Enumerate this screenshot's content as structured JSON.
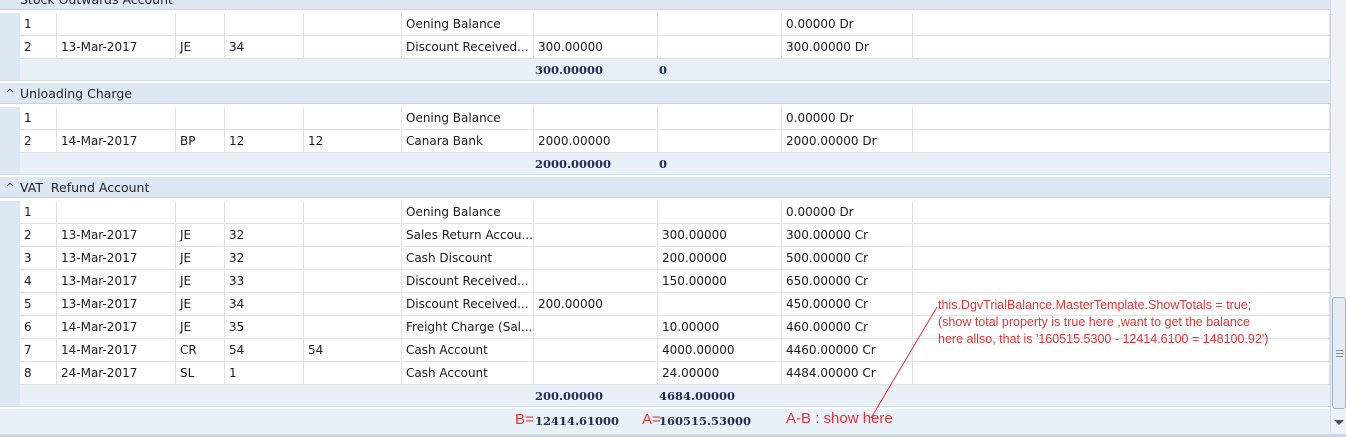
{
  "groups": [
    {
      "title": "Stock Outwards Account",
      "rows": [
        {
          "no": "1",
          "date": "",
          "type": "",
          "vno": "",
          "ref": "",
          "particulars": "Oening Balance",
          "debit": "",
          "credit": "",
          "balance": "0.00000 Dr"
        },
        {
          "no": "2",
          "date": "13-Mar-2017",
          "type": "JE",
          "vno": "34",
          "ref": "",
          "particulars": "Discount Received...",
          "debit": "300.00000",
          "credit": "",
          "balance": "300.00000 Dr"
        }
      ],
      "totals": {
        "debit": "300.00000",
        "credit": "0"
      }
    },
    {
      "title": "Unloading Charge",
      "rows": [
        {
          "no": "1",
          "date": "",
          "type": "",
          "vno": "",
          "ref": "",
          "particulars": "Oening Balance",
          "debit": "",
          "credit": "",
          "balance": "0.00000 Dr"
        },
        {
          "no": "2",
          "date": "14-Mar-2017",
          "type": "BP",
          "vno": "12",
          "ref": "12",
          "particulars": "Canara Bank",
          "debit": "2000.00000",
          "credit": "",
          "balance": "2000.00000 Dr"
        }
      ],
      "totals": {
        "debit": "2000.00000",
        "credit": "0"
      }
    },
    {
      "title": "VAT  Refund Account",
      "rows": [
        {
          "no": "1",
          "date": "",
          "type": "",
          "vno": "",
          "ref": "",
          "particulars": "Oening Balance",
          "debit": "",
          "credit": "",
          "balance": "0.00000 Dr"
        },
        {
          "no": "2",
          "date": "13-Mar-2017",
          "type": "JE",
          "vno": "32",
          "ref": "",
          "particulars": "Sales Return Accou...",
          "debit": "",
          "credit": "300.00000",
          "balance": "300.00000 Cr"
        },
        {
          "no": "3",
          "date": "13-Mar-2017",
          "type": "JE",
          "vno": "32",
          "ref": "",
          "particulars": "Cash Discount",
          "debit": "",
          "credit": "200.00000",
          "balance": "500.00000 Cr"
        },
        {
          "no": "4",
          "date": "13-Mar-2017",
          "type": "JE",
          "vno": "33",
          "ref": "",
          "particulars": "Discount Received...",
          "debit": "",
          "credit": "150.00000",
          "balance": "650.00000 Cr"
        },
        {
          "no": "5",
          "date": "13-Mar-2017",
          "type": "JE",
          "vno": "34",
          "ref": "",
          "particulars": "Discount Received...",
          "debit": "200.00000",
          "credit": "",
          "balance": "450.00000 Cr"
        },
        {
          "no": "6",
          "date": "14-Mar-2017",
          "type": "JE",
          "vno": "35",
          "ref": "",
          "particulars": "Freight Charge (Sal...",
          "debit": "",
          "credit": "10.00000",
          "balance": "460.00000 Cr"
        },
        {
          "no": "7",
          "date": "14-Mar-2017",
          "type": "CR",
          "vno": "54",
          "ref": "54",
          "particulars": "Cash Account",
          "debit": "",
          "credit": "4000.00000",
          "balance": "4460.00000 Cr"
        },
        {
          "no": "8",
          "date": "24-Mar-2017",
          "type": "SL",
          "vno": "1",
          "ref": "",
          "particulars": "Cash Account",
          "debit": "",
          "credit": "24.00000",
          "balance": "4484.00000 Cr"
        }
      ],
      "totals": {
        "debit": "200.00000",
        "credit": "4684.00000"
      }
    }
  ],
  "master_totals": {
    "debit": "12414.61000",
    "credit": "160515.53000",
    "label_b": "B=",
    "label_a": "A=",
    "label_ab": "A-B : show here"
  },
  "annotation": {
    "line1": "this.DgvTrialBalance.MasterTemplate.ShowTotals = true;",
    "line2": "(show total property is true here ,want to get the balance",
    "line3": "here allso, that is  '160515.5300 - 12414.6100 = 148100.92')",
    "color": "#e23535"
  },
  "colors": {
    "group_header_bg": "#dde8f4",
    "summary_bg": "#eaf0f7",
    "summary_text": "#1f2a55",
    "grid_line": "#dfe3e8"
  },
  "icons": {
    "group_toggle": "chevron-up-icon",
    "scroll_grip": "grip-lines-icon",
    "scroll_down": "scroll-down-arrow-icon"
  }
}
